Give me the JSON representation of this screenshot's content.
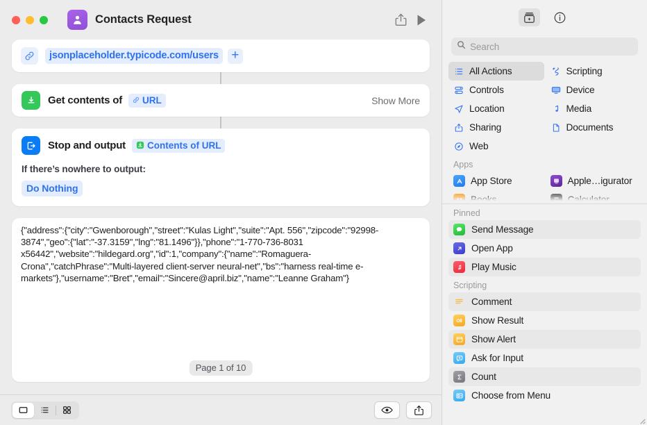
{
  "window": {
    "title": "Contacts Request",
    "icon": "contact-person-icon",
    "traffic_lights": [
      "close",
      "minimize",
      "zoom"
    ],
    "share_icon": "share-icon",
    "run_icon": "play-run-icon"
  },
  "editor": {
    "actions": [
      {
        "type": "url",
        "icon": "link-icon",
        "value": "jsonplaceholder.typicode.com/users",
        "add_label": "+"
      },
      {
        "type": "get_contents",
        "icon": "download-url-icon",
        "label": "Get contents of",
        "token": "URL",
        "token_icon": "link-icon",
        "trailing": "Show More"
      },
      {
        "type": "stop_output",
        "icon": "stop-output-icon",
        "label": "Stop and output",
        "token": "Contents of URL",
        "token_icon": "download-url-icon",
        "sub_label": "If there’s nowhere to output:",
        "sub_choice": "Do Nothing"
      }
    ],
    "result": {
      "text": "{\"address\":{\"city\":\"Gwenborough\",\"street\":\"Kulas Light\",\"suite\":\"Apt. 556\",\"zipcode\":\"92998-3874\",\"geo\":{\"lat\":\"-37.3159\",\"lng\":\"81.1496\"}},\"phone\":\"1-770-736-8031 x56442\",\"website\":\"hildegard.org\",\"id\":1,\"company\":{\"name\":\"Romaguera-Crona\",\"catchPhrase\":\"Multi-layered client-server neural-net\",\"bs\":\"harness real-time e-markets\"},\"username\":\"Bret\",\"email\":\"Sincere@april.biz\",\"name\":\"Leanne Graham\"}",
      "page_indicator": "Page 1 of 10"
    },
    "bottom_bar": {
      "view_modes": [
        {
          "name": "single-view",
          "icon": "rectangle-icon",
          "selected": true
        },
        {
          "name": "list-view",
          "icon": "list-icon",
          "selected": false
        },
        {
          "name": "grid-view",
          "icon": "grid-icon",
          "selected": false
        }
      ],
      "preview_icon": "eye-icon",
      "export_icon": "share-icon"
    }
  },
  "sidebar": {
    "toolbar": [
      {
        "name": "action-library",
        "icon": "library-add-icon",
        "active": true
      },
      {
        "name": "shortcut-details",
        "icon": "info-circle-icon",
        "active": false
      }
    ],
    "search": {
      "placeholder": "Search",
      "value": "",
      "icon": "search-icon"
    },
    "categories": [
      {
        "label": "All Actions",
        "icon": "list-bullets-icon",
        "selected": true,
        "color": "#3576f3"
      },
      {
        "label": "Scripting",
        "icon": "scripting-icon",
        "selected": false,
        "color": "#3576f3"
      },
      {
        "label": "Controls",
        "icon": "controls-icon",
        "selected": false,
        "color": "#3576f3"
      },
      {
        "label": "Device",
        "icon": "display-icon",
        "selected": false,
        "color": "#3576f3"
      },
      {
        "label": "Location",
        "icon": "navigation-icon",
        "selected": false,
        "color": "#3576f3"
      },
      {
        "label": "Media",
        "icon": "music-note-icon",
        "selected": false,
        "color": "#3576f3"
      },
      {
        "label": "Sharing",
        "icon": "share-icon",
        "selected": false,
        "color": "#3576f3"
      },
      {
        "label": "Documents",
        "icon": "document-icon",
        "selected": false,
        "color": "#3576f3"
      },
      {
        "label": "Web",
        "icon": "safari-compass-icon",
        "selected": false,
        "color": "#3576f3"
      }
    ],
    "apps_section": {
      "title": "Apps",
      "items": [
        {
          "label": "App Store",
          "icon": "app-store-icon",
          "color": "#2f8bf5"
        },
        {
          "label": "Apple…igurator",
          "icon": "apple-configurator-icon",
          "color": "#7b3fb5"
        },
        {
          "label": "Books",
          "icon": "books-icon",
          "color": "#f5a623"
        },
        {
          "label": "Calculator",
          "icon": "calculator-icon",
          "color": "#5c5c60"
        }
      ]
    },
    "pinned_section": {
      "title": "Pinned",
      "items": [
        {
          "label": "Send Message",
          "icon": "messages-icon",
          "color": "#3ac84c",
          "alt": true
        },
        {
          "label": "Open App",
          "icon": "open-app-icon",
          "color": "#4f4fd8",
          "alt": false
        },
        {
          "label": "Play Music",
          "icon": "music-app-icon",
          "color": "#f2474f",
          "alt": true
        }
      ]
    },
    "scripting_section": {
      "title": "Scripting",
      "items": [
        {
          "label": "Comment",
          "icon": "comment-lines-icon",
          "color": "#f6b93b",
          "alt": true
        },
        {
          "label": "Show Result",
          "icon": "show-result-icon",
          "color": "#f6b93b",
          "alt": false
        },
        {
          "label": "Show Alert",
          "icon": "show-alert-icon",
          "color": "#f6b93b",
          "alt": true
        },
        {
          "label": "Ask for Input",
          "icon": "ask-input-icon",
          "color": "#53b8f5",
          "alt": false
        },
        {
          "label": "Count",
          "icon": "sigma-count-icon",
          "color": "#8e8e93",
          "alt": true
        },
        {
          "label": "Choose from Menu",
          "icon": "choose-menu-icon",
          "color": "#53b8f5",
          "alt": false
        }
      ]
    }
  }
}
